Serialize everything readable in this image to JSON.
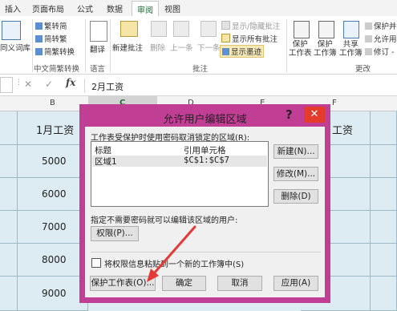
{
  "ribbon_tabs": [
    "插入",
    "页面布局",
    "公式",
    "数据",
    "审阅",
    "视图"
  ],
  "ribbon": {
    "thesaurus_label": "同义词库",
    "to_traditional": "繁转简",
    "to_simplified": "简转繁",
    "convert": "简繁转换",
    "group_chinese": "中文简繁转换",
    "translate": "翻译",
    "group_language": "语言",
    "new_comment": "新建批注",
    "delete": "删除",
    "previous": "上一条",
    "next": "下一条",
    "show_hide_comment": "显示/隐藏批注",
    "show_all_comments": "显示所有批注",
    "show_ink": "显示墨迹",
    "group_comments": "批注",
    "protect_sheet": "保护\n工作表",
    "protect_workbook": "保护\n工作簿",
    "share_workbook": "共享\n工作簿",
    "protect_and_share": "保护并",
    "allow_edit": "允许用",
    "track_changes": "修订 -",
    "group_changes": "更改"
  },
  "formula_bar": {
    "cancel": "✕",
    "enter": "✓",
    "fx": "fx",
    "value": "2月工资"
  },
  "columns": [
    "B",
    "C",
    "D",
    "E",
    "F"
  ],
  "sheet": {
    "header_b": "1月工资",
    "header_f": "工资",
    "values": [
      "5000",
      "6000",
      "7000",
      "8000",
      "9000"
    ]
  },
  "dialog": {
    "title": "允许用户编辑区域",
    "help": "?",
    "close": "✕",
    "intro": "工作表受保护时使用密码取消锁定的区域(R):",
    "list_header_title": "标题",
    "list_header_ref": "引用单元格",
    "range_name": "区域1",
    "range_ref": "$C$1:$C$7",
    "new_button": "新建(N)...",
    "modify_button": "修改(M)...",
    "delete_button": "删除(D)",
    "no_password_text": "指定不需要密码就可以编辑该区域的用户:",
    "permissions_button": "权限(P)...",
    "paste_checkbox_label": "将权限信息粘贴到一个新的工作簿中(S)",
    "protect_sheet_button": "保护工作表(O)...",
    "ok_button": "确定",
    "cancel_button": "取消",
    "apply_button": "应用(A)"
  },
  "colors": {
    "dialog_border": "#c13e95",
    "close_red": "#e43c2c",
    "arrow_red": "#e53935",
    "cell_fill": "#dcecf2"
  }
}
